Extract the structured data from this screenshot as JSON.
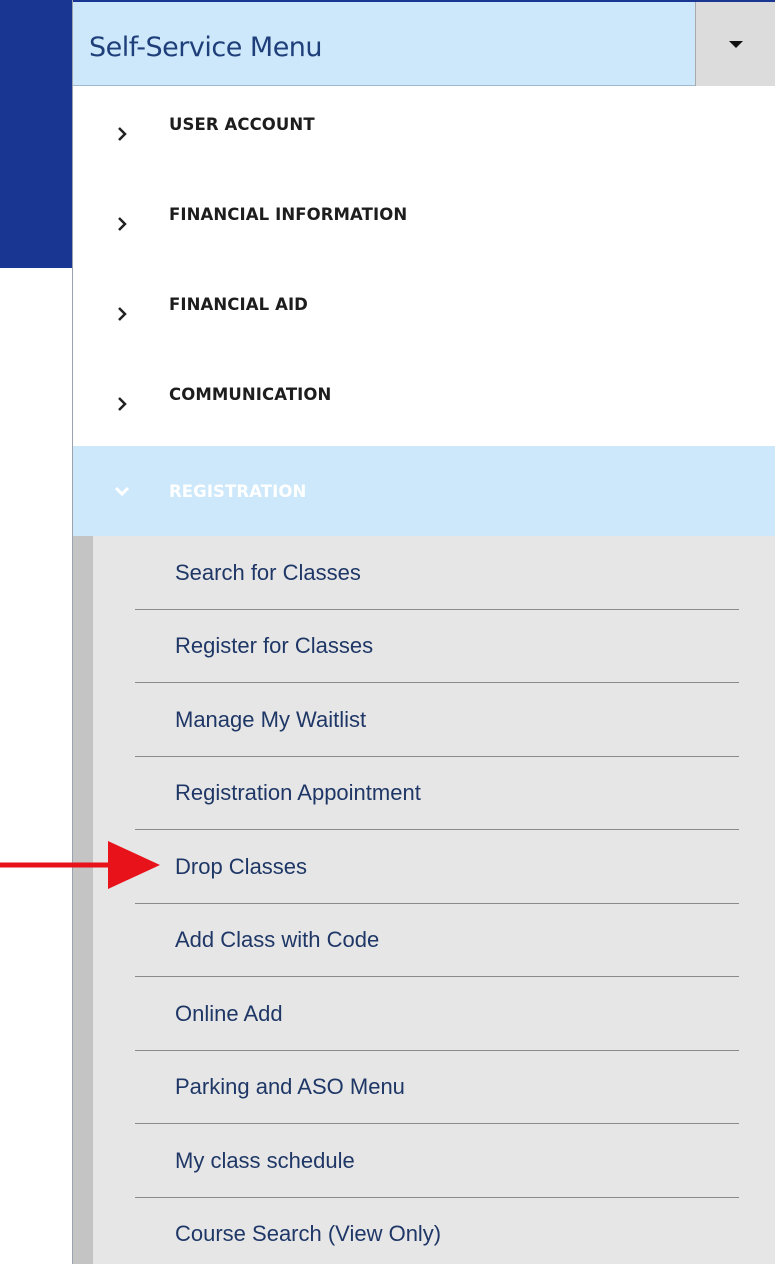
{
  "menu": {
    "title": "Self-Service Menu",
    "categories": [
      {
        "label": "USER ACCOUNT"
      },
      {
        "label": "FINANCIAL INFORMATION"
      },
      {
        "label": "FINANCIAL AID"
      },
      {
        "label": "COMMUNICATION"
      },
      {
        "label": "REGISTRATION"
      }
    ],
    "registration_items": [
      {
        "label": "Search for Classes"
      },
      {
        "label": "Register for Classes"
      },
      {
        "label": "Manage My Waitlist"
      },
      {
        "label": "Registration Appointment"
      },
      {
        "label": "Drop Classes"
      },
      {
        "label": "Add Class with Code"
      },
      {
        "label": "Online Add"
      },
      {
        "label": "Parking and ASO Menu"
      },
      {
        "label": "My class schedule"
      },
      {
        "label": "Course Search (View Only)"
      }
    ]
  },
  "annotation": {
    "icon": "red-arrow-icon",
    "points_to": "Drop Classes",
    "color": "#e8121a"
  },
  "colors": {
    "banner": "#1a3693",
    "header_bg": "#cde8fb",
    "submenu_bg": "#e6e6e6",
    "submenu_text": "#1f3766"
  }
}
